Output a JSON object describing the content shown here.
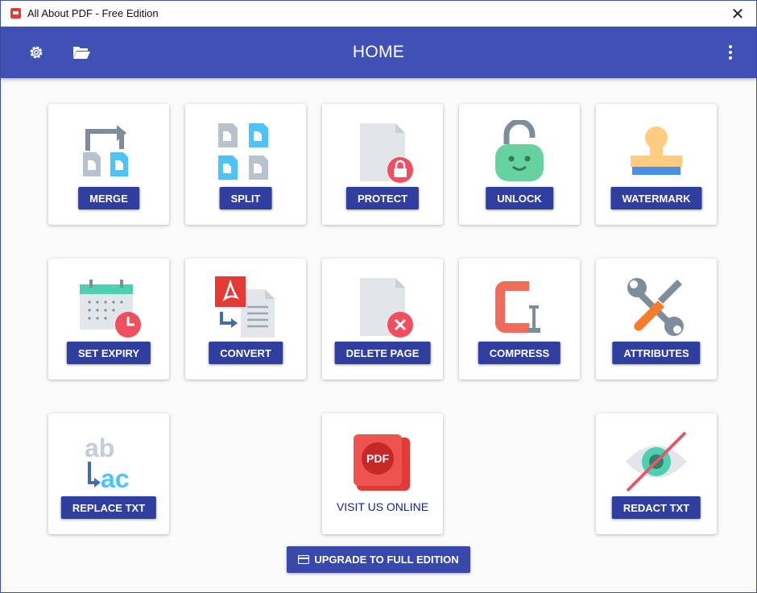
{
  "window": {
    "title": "All About PDF - Free Edition",
    "close_label": "✕"
  },
  "appbar": {
    "title": "HOME"
  },
  "tools": [
    {
      "label": "MERGE"
    },
    {
      "label": "SPLIT"
    },
    {
      "label": "PROTECT"
    },
    {
      "label": "UNLOCK"
    },
    {
      "label": "WATERMARK"
    },
    {
      "label": "SET EXPIRY"
    },
    {
      "label": "CONVERT"
    },
    {
      "label": "DELETE PAGE"
    },
    {
      "label": "COMPRESS"
    },
    {
      "label": "ATTRIBUTES"
    },
    {
      "label": "REPLACE TXT"
    },
    {
      "label": "VISIT US ONLINE",
      "icon_text": "PDF"
    },
    {
      "label": "REDACT TXT"
    }
  ],
  "upgrade": {
    "label": "UPGRADE TO FULL EDITION"
  },
  "colors": {
    "appbar": "#3f51b5",
    "button": "#303f9f",
    "accent_red": "#ef4f5f",
    "accent_blue": "#4fc3f7",
    "accent_green": "#66d2a0"
  }
}
